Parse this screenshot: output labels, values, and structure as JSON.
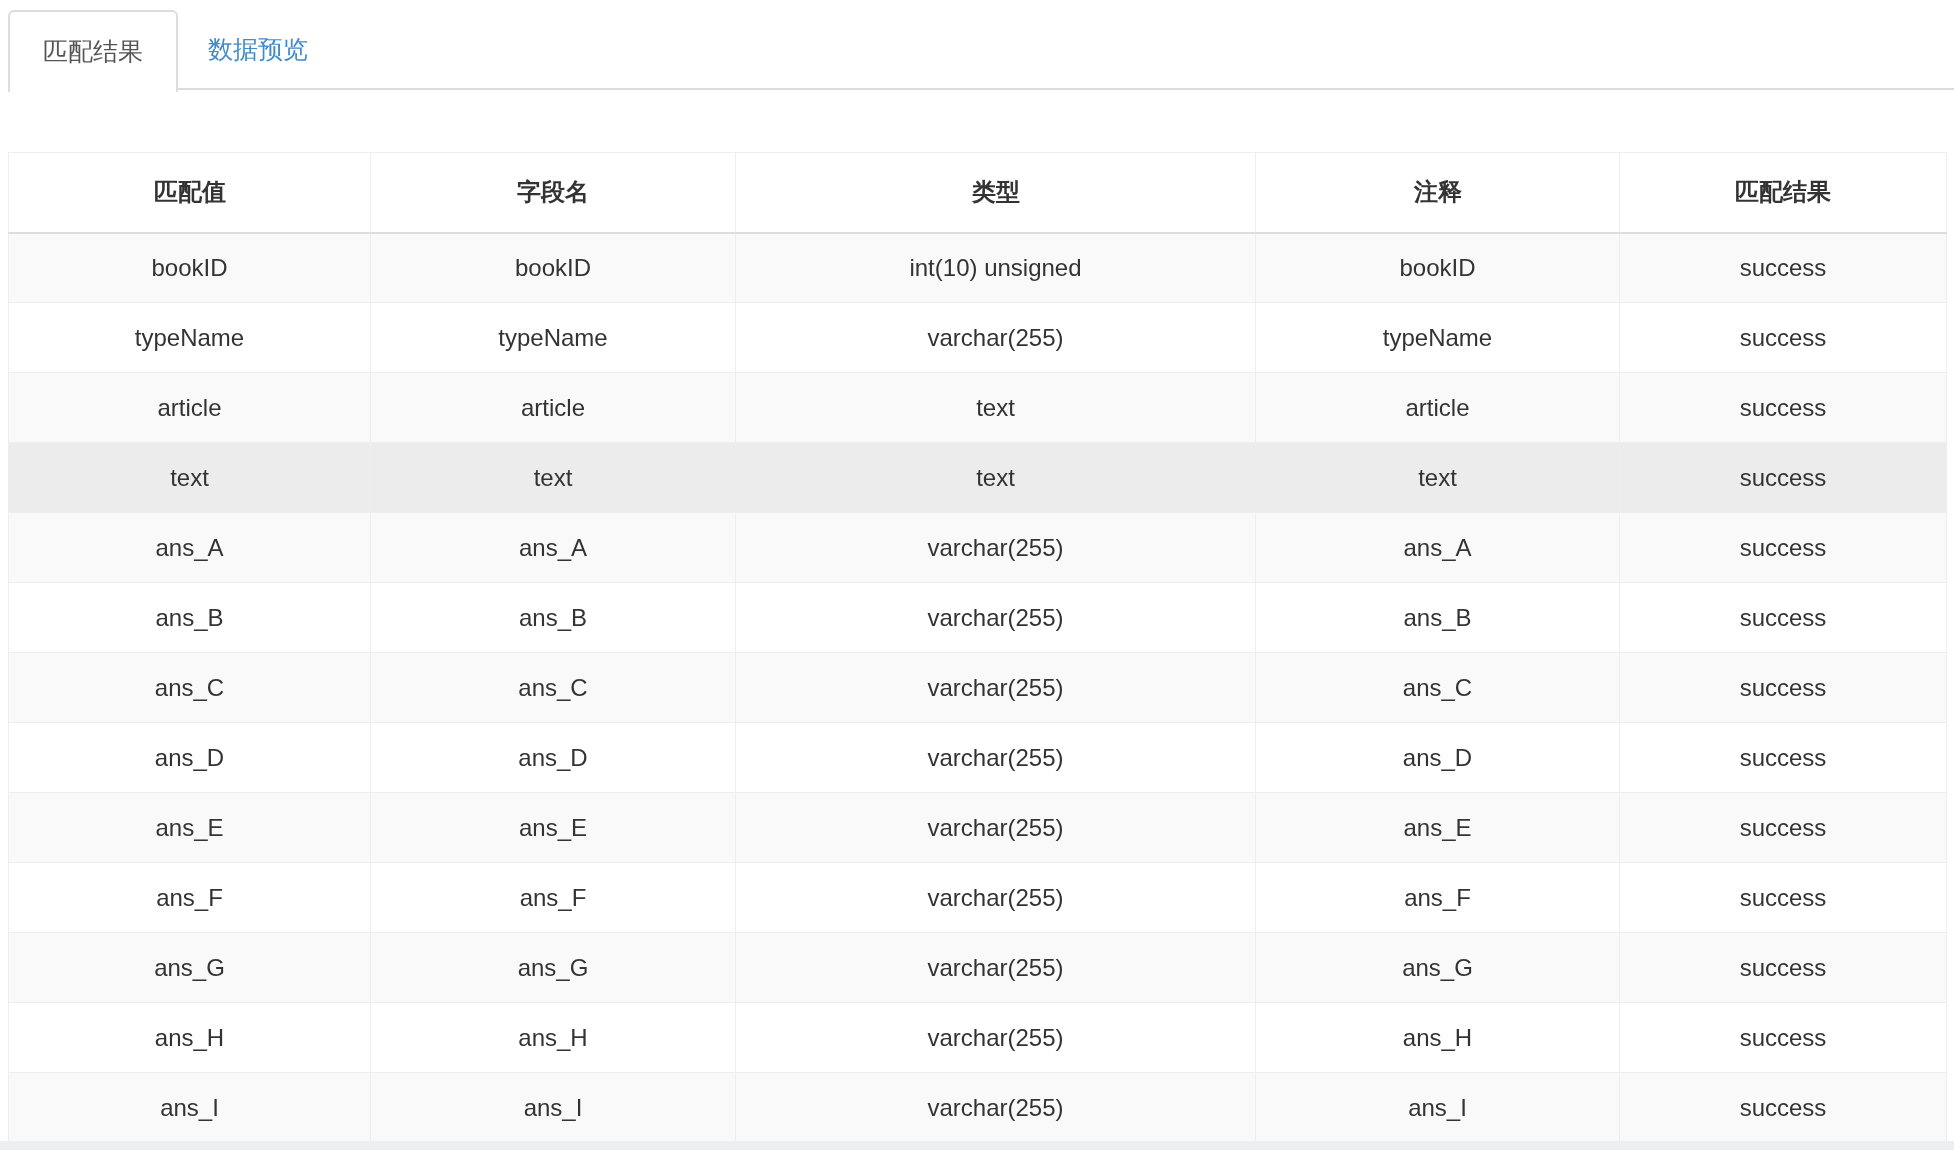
{
  "tabs": [
    {
      "label": "匹配结果",
      "selected": true
    },
    {
      "label": "数据预览",
      "selected": false
    }
  ],
  "table": {
    "columns": [
      "匹配值",
      "字段名",
      "类型",
      "注释",
      "匹配结果"
    ],
    "rows": [
      {
        "cells": [
          "bookID",
          "bookID",
          "int(10) unsigned",
          "bookID",
          "success"
        ],
        "hovered": false
      },
      {
        "cells": [
          "typeName",
          "typeName",
          "varchar(255)",
          "typeName",
          "success"
        ],
        "hovered": false
      },
      {
        "cells": [
          "article",
          "article",
          "text",
          "article",
          "success"
        ],
        "hovered": false
      },
      {
        "cells": [
          "text",
          "text",
          "text",
          "text",
          "success"
        ],
        "hovered": true
      },
      {
        "cells": [
          "ans_A",
          "ans_A",
          "varchar(255)",
          "ans_A",
          "success"
        ],
        "hovered": false
      },
      {
        "cells": [
          "ans_B",
          "ans_B",
          "varchar(255)",
          "ans_B",
          "success"
        ],
        "hovered": false
      },
      {
        "cells": [
          "ans_C",
          "ans_C",
          "varchar(255)",
          "ans_C",
          "success"
        ],
        "hovered": false
      },
      {
        "cells": [
          "ans_D",
          "ans_D",
          "varchar(255)",
          "ans_D",
          "success"
        ],
        "hovered": false
      },
      {
        "cells": [
          "ans_E",
          "ans_E",
          "varchar(255)",
          "ans_E",
          "success"
        ],
        "hovered": false
      },
      {
        "cells": [
          "ans_F",
          "ans_F",
          "varchar(255)",
          "ans_F",
          "success"
        ],
        "hovered": false
      },
      {
        "cells": [
          "ans_G",
          "ans_G",
          "varchar(255)",
          "ans_G",
          "success"
        ],
        "hovered": false
      },
      {
        "cells": [
          "ans_H",
          "ans_H",
          "varchar(255)",
          "ans_H",
          "success"
        ],
        "hovered": false
      },
      {
        "cells": [
          "ans_I",
          "ans_I",
          "varchar(255)",
          "ans_I",
          "success"
        ],
        "hovered": false
      }
    ]
  }
}
